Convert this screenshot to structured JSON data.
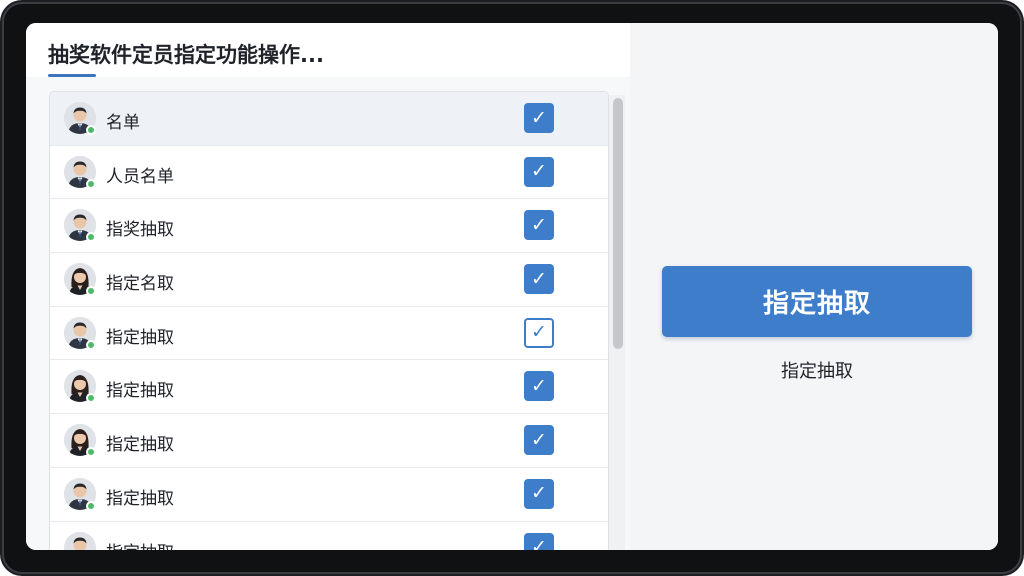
{
  "header": {
    "title": "抽奖软件定员指定功能操作..."
  },
  "list": {
    "items": [
      {
        "label": "名单",
        "avatar": "male-avatar-icon",
        "checked": true,
        "style": "filled",
        "selected": true
      },
      {
        "label": "人员名单",
        "avatar": "male-avatar-icon",
        "checked": true,
        "style": "filled",
        "selected": false
      },
      {
        "label": "指奖抽取",
        "avatar": "male-avatar-icon",
        "checked": true,
        "style": "filled",
        "selected": false
      },
      {
        "label": "指定名取",
        "avatar": "female-avatar-icon",
        "checked": true,
        "style": "filled",
        "selected": false
      },
      {
        "label": "指定抽取",
        "avatar": "male-avatar-icon",
        "checked": true,
        "style": "outline",
        "selected": false
      },
      {
        "label": "指定抽取",
        "avatar": "female-avatar-icon",
        "checked": true,
        "style": "filled",
        "selected": false
      },
      {
        "label": "指定抽取",
        "avatar": "female-avatar-icon",
        "checked": true,
        "style": "filled",
        "selected": false
      },
      {
        "label": "指定抽取",
        "avatar": "male-avatar-icon",
        "checked": true,
        "style": "filled",
        "selected": false
      },
      {
        "label": "指定抽取",
        "avatar": "male-avatar-icon",
        "checked": true,
        "style": "filled",
        "selected": false
      }
    ],
    "check_glyph": "✓"
  },
  "action": {
    "button_label": "指定抽取",
    "caption": "指定抽取"
  },
  "colors": {
    "accent": "#3d7dca",
    "online": "#4fb96a",
    "title_text": "#1f2329"
  }
}
